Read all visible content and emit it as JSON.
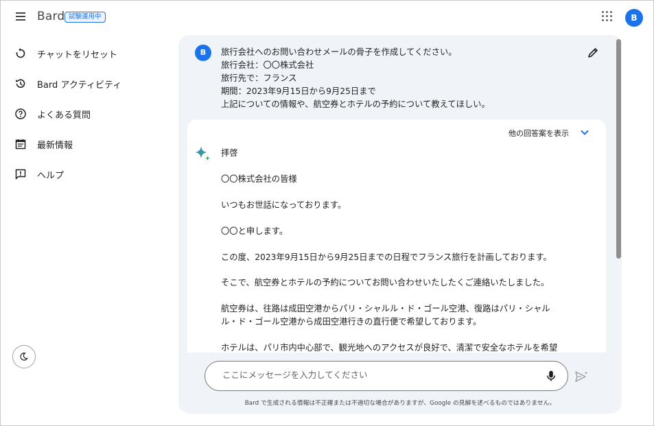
{
  "header": {
    "logo": "Bard",
    "badge": "試験運用中",
    "avatar_letter": "B"
  },
  "sidebar": {
    "items": [
      {
        "label": "チャットをリセット",
        "icon": "reset-icon"
      },
      {
        "label": "Bard アクティビティ",
        "icon": "history-icon"
      },
      {
        "label": "よくある質問",
        "icon": "help-circle-icon"
      },
      {
        "label": "最新情報",
        "icon": "calendar-icon"
      },
      {
        "label": "ヘルプ",
        "icon": "feedback-icon"
      }
    ],
    "theme_icon": "moon-icon"
  },
  "conversation": {
    "user_avatar": "B",
    "prompt_lines": [
      "旅行会社へのお問い合わせメールの骨子を作成してください。",
      "旅行会社：〇〇株式会社",
      "旅行先で：フランス",
      "期間：2023年9月15日から9月25日まで",
      "上記についての情報や、航空券とホテルの予約について教えてほしい。"
    ],
    "drafts_label": "他の回答案を表示",
    "response_lines": [
      "拝啓",
      "〇〇株式会社の皆様",
      "いつもお世話になっております。",
      "〇〇と申します。",
      "この度、2023年9月15日から9月25日までの日程でフランス旅行を計画しております。",
      "そこで、航空券とホテルの予約についてお問い合わせいたしたくご連絡いたしました。",
      "航空券は、往路は成田空港からパリ・シャルル・ド・ゴール空港、復路はパリ・シャル",
      "ル・ド・ゴール空港から成田空港行きの直行便で希望しております。",
      "ホテルは、パリ市内中心部で、観光地へのアクセスが良好で、清潔で安全なホテルを希望"
    ]
  },
  "input": {
    "placeholder": "ここにメッセージを入力してください",
    "value": ""
  },
  "footer": {
    "disclaimer": "Bard で生成される情報は不正確または不適切な場合がありますが、Google の見解を述べるものではありません。"
  },
  "colors": {
    "accent": "#1a73e8",
    "main_bg": "#f0f4f9",
    "sparkle_blue": "#4285f4",
    "sparkle_teal": "#34a853"
  }
}
